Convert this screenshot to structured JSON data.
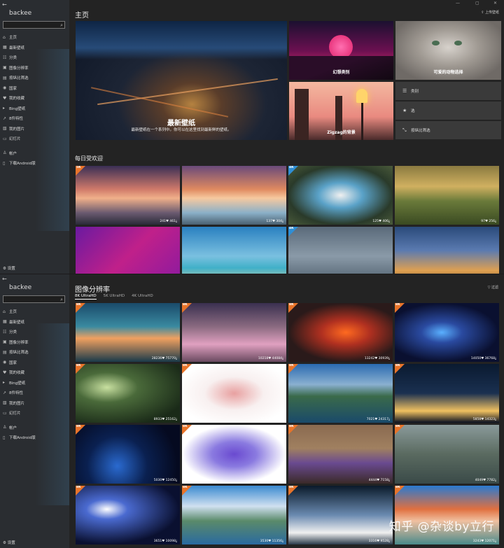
{
  "colors": {
    "badge_8k": "#e8742a",
    "badge_4k": "#2f8fd6",
    "sidebar": "#2a2d31",
    "main": "#232323"
  },
  "app": {
    "name": "backee",
    "back_icon": "back-arrow-icon"
  },
  "window_controls": [
    "—",
    "▢",
    "✕"
  ],
  "sidebar": {
    "search_icon": "search-icon",
    "items": [
      {
        "icon": "home-icon",
        "glyph": "⌂",
        "label": "主页"
      },
      {
        "icon": "new-icon",
        "glyph": "▦",
        "label": "最新壁纸"
      },
      {
        "icon": "category-icon",
        "glyph": "☷",
        "label": "分类"
      },
      {
        "icon": "resolution-icon",
        "glyph": "▣",
        "label": "图像分辨率"
      },
      {
        "icon": "ratio-icon",
        "glyph": "▤",
        "label": "按纵比筛选"
      },
      {
        "icon": "globe-icon",
        "glyph": "◉",
        "label": "国家"
      },
      {
        "icon": "favorites-icon",
        "glyph": "♥",
        "label": "我的收藏"
      },
      {
        "icon": "bing-icon",
        "glyph": "▸",
        "label": "Bing壁纸"
      },
      {
        "icon": "trend-icon",
        "glyph": "↗",
        "label": "8件特性"
      },
      {
        "icon": "photos-icon",
        "glyph": "▧",
        "label": "我的图片"
      },
      {
        "icon": "slideshow-icon",
        "glyph": "▭",
        "label": "幻灯片"
      }
    ],
    "bottom_items": [
      {
        "icon": "account-icon",
        "glyph": "♙",
        "label": "帐户"
      },
      {
        "icon": "android-icon",
        "glyph": "▯",
        "label": "下载Android版"
      }
    ],
    "settings": {
      "icon": "gear-icon",
      "glyph": "⚙",
      "label": "设置"
    }
  },
  "home": {
    "title": "主页",
    "upload": "⇪ 上传壁纸",
    "hero": {
      "title": "最新壁纸",
      "subtitle": "最新壁纸在一个系列中。你可以在这里找到最新鲜的壁纸。"
    },
    "tiles": [
      {
        "label": "幻想类别"
      },
      {
        "label": "可爱的动物选择"
      },
      {
        "label": "Zigzag的背景"
      }
    ],
    "menu": [
      {
        "icon": "list-icon",
        "glyph": "☰",
        "label": "类别"
      },
      {
        "icon": "star-icon",
        "glyph": "★",
        "label": "选"
      },
      {
        "icon": "ratio-icon",
        "glyph": "⤡",
        "label": "按纵比筛选"
      }
    ],
    "daily_title": "每日受欢迎",
    "daily": [
      {
        "badge": "5K",
        "stats": "241♥ 461⤓"
      },
      {
        "badge": "",
        "stats": "137♥ 304⤓"
      },
      {
        "badge": "4K",
        "stats": "125♥ 406⤓"
      },
      {
        "badge": "",
        "stats": "97♥ 256⤓"
      },
      {
        "badge": "",
        "stats": ""
      },
      {
        "badge": "",
        "stats": ""
      },
      {
        "badge": "4K",
        "stats": ""
      },
      {
        "badge": "",
        "stats": ""
      }
    ]
  },
  "resolution": {
    "title": "图像分辨率",
    "filter": "▽ 过滤",
    "tabs": [
      "8K UltraHD",
      "5K UltraHD",
      "4K UltraHD"
    ],
    "grid": [
      {
        "badge": "8K",
        "stats": "28236♥ 75770⤓"
      },
      {
        "badge": "8K",
        "stats": "10218♥ 44084⤓"
      },
      {
        "badge": "8K",
        "stats": "13242♥ 30939⤓"
      },
      {
        "badge": "8K",
        "stats": "14050♥ 36768⤓"
      },
      {
        "badge": "8K",
        "stats": "8933♥ 25162⤓"
      },
      {
        "badge": "8K",
        "stats": "7735♥ 16870⤓"
      },
      {
        "badge": "8K",
        "stats": "7021♥ 24317⤓"
      },
      {
        "badge": "8K",
        "stats": "5858♥ 14323⤓"
      },
      {
        "badge": "8K",
        "stats": "5030♥ 12450⤓"
      },
      {
        "badge": "8K",
        "stats": "4512♥ 9850⤓"
      },
      {
        "badge": "8K",
        "stats": "4444♥ 7158⤓"
      },
      {
        "badge": "8K",
        "stats": "4049♥ 7782⤓"
      },
      {
        "badge": "8K",
        "stats": "3651♥ 10098⤓"
      },
      {
        "badge": "8K",
        "stats": "3530♥ 11356⤓"
      },
      {
        "badge": "8K",
        "stats": "3316♥ 9528⤓"
      },
      {
        "badge": "8K",
        "stats": "3243♥ 12071⤓"
      }
    ]
  },
  "watermark": "知乎 @杂谈by立行"
}
